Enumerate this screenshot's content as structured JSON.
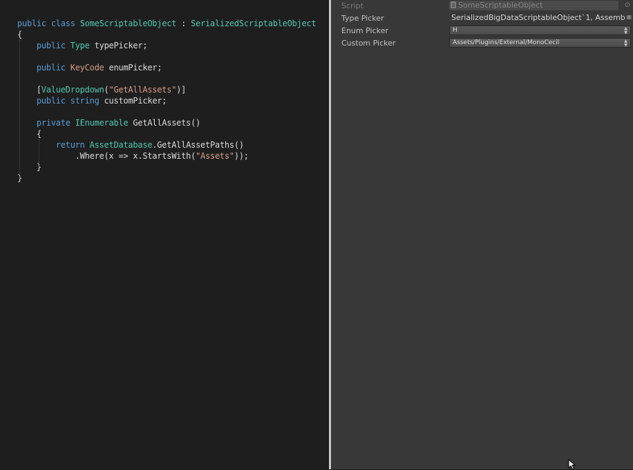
{
  "editor": {
    "lines": [
      [
        {
          "t": "public ",
          "c": "kw"
        },
        {
          "t": "class ",
          "c": "kw"
        },
        {
          "t": "SomeScriptableObject",
          "c": "ty"
        },
        {
          "t": " : ",
          "c": ""
        },
        {
          "t": "SerializedScriptableObject",
          "c": "ty"
        }
      ],
      [
        {
          "t": "{",
          "c": ""
        }
      ],
      [
        {
          "t": "    ",
          "c": ""
        },
        {
          "t": "public ",
          "c": "kw"
        },
        {
          "t": "Type",
          "c": "ty"
        },
        {
          "t": " typePicker;",
          "c": ""
        }
      ],
      [],
      [
        {
          "t": "    ",
          "c": ""
        },
        {
          "t": "public ",
          "c": "kw"
        },
        {
          "t": "KeyCode",
          "c": "st"
        },
        {
          "t": " enumPicker;",
          "c": ""
        }
      ],
      [],
      [
        {
          "t": "    [",
          "c": ""
        },
        {
          "t": "ValueDropdown",
          "c": "ty"
        },
        {
          "t": "(",
          "c": ""
        },
        {
          "t": "\"GetAllAssets\"",
          "c": "st"
        },
        {
          "t": ")]",
          "c": ""
        }
      ],
      [
        {
          "t": "    ",
          "c": ""
        },
        {
          "t": "public ",
          "c": "kw"
        },
        {
          "t": "string",
          "c": "kw"
        },
        {
          "t": " customPicker;",
          "c": ""
        }
      ],
      [],
      [
        {
          "t": "    ",
          "c": ""
        },
        {
          "t": "private ",
          "c": "kw"
        },
        {
          "t": "IEnumerable",
          "c": "ty"
        },
        {
          "t": " GetAllAssets()",
          "c": ""
        }
      ],
      [
        {
          "t": "    {",
          "c": ""
        }
      ],
      [
        {
          "t": "        ",
          "c": ""
        },
        {
          "t": "return ",
          "c": "kw"
        },
        {
          "t": "AssetDatabase",
          "c": "ty"
        },
        {
          "t": ".GetAllAssetPaths()",
          "c": ""
        }
      ],
      [
        {
          "t": "            .Where(x => x.StartsWith(",
          "c": ""
        },
        {
          "t": "\"Assets\"",
          "c": "st"
        },
        {
          "t": "));",
          "c": ""
        }
      ],
      [
        {
          "t": "    }",
          "c": ""
        }
      ],
      [
        {
          "t": "}",
          "c": ""
        }
      ]
    ]
  },
  "inspector": {
    "script": {
      "label": "Script",
      "value": "SomeScriptableObject"
    },
    "type_picker": {
      "label": "Type Picker",
      "value": "SerializedBigDataScriptableObject`1, Assemb"
    },
    "enum_picker": {
      "label": "Enum Picker",
      "value": "H"
    },
    "custom_picker": {
      "label": "Custom Picker",
      "value": "Assets/Plugins/External/MonoCecil"
    }
  },
  "icons": {
    "script_field": "script-file-icon",
    "object_picker": "object-picker-icon",
    "type_selector": "type-selector-icon",
    "dropdown_arrows": "dropdown-arrows-icon",
    "cursor": "mouse-cursor-icon"
  },
  "colors": {
    "editor_bg": "#1e1e1e",
    "keyword": "#569cd6",
    "type": "#4ec9b0",
    "string": "#d69d85",
    "inspector_bg": "#383838"
  }
}
